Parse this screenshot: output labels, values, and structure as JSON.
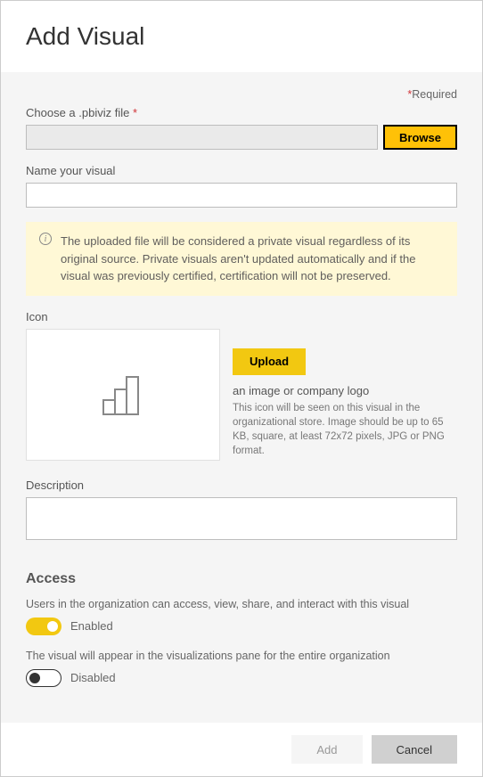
{
  "header": {
    "title": "Add Visual"
  },
  "required_label": "Required",
  "file": {
    "label": "Choose a .pbiviz file",
    "required": true,
    "browse": "Browse"
  },
  "name": {
    "label": "Name your visual",
    "value": ""
  },
  "info": "The uploaded file will be considered a private visual regardless of its original source. Private visuals aren't updated automatically and if the visual was previously certified, certification will not be preserved.",
  "icon": {
    "label": "Icon",
    "upload": "Upload",
    "subtitle": "an image or company logo",
    "help": "This icon will be seen on this visual in the organizational store. Image should be up to 65 KB, square, at least 72x72 pixels, JPG or PNG format."
  },
  "description": {
    "label": "Description",
    "value": ""
  },
  "access": {
    "title": "Access",
    "row1": {
      "desc": "Users in the organization can access, view, share, and interact with this visual",
      "state": "Enabled"
    },
    "row2": {
      "desc": "The visual will appear in the visualizations pane for the entire organization",
      "state": "Disabled"
    }
  },
  "footer": {
    "add": "Add",
    "cancel": "Cancel"
  }
}
